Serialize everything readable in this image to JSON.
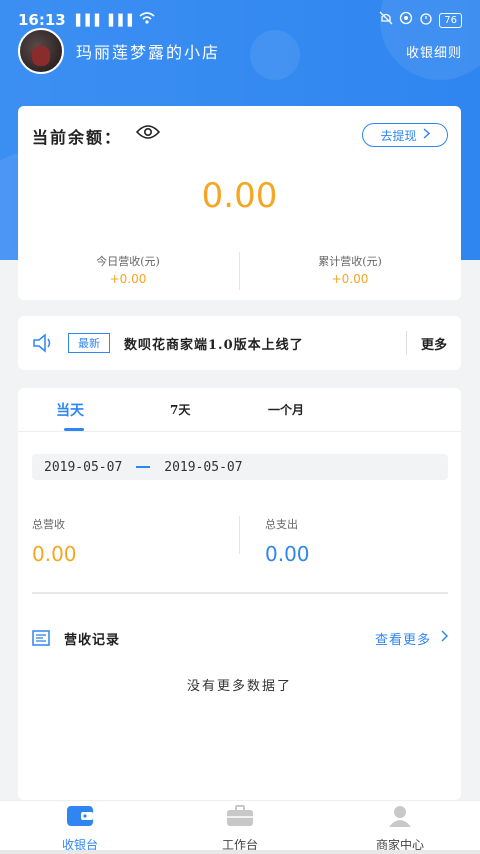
{
  "status_bar": {
    "time": "16:13",
    "signal_text": "▐▐▐ ▐▐▐",
    "battery": "76"
  },
  "header": {
    "shop_name": "玛丽莲梦露的小店",
    "details_link": "收银细则"
  },
  "balance": {
    "title": "当前余额：",
    "withdraw_label": "去提现",
    "amount": "0.00",
    "today_label": "今日营收(元)",
    "today_value": "+0.00",
    "total_label": "累计营收(元)",
    "total_value": "+0.00"
  },
  "notice": {
    "tag": "最新",
    "text": "数呗花商家端1.0版本上线了",
    "more": "更多"
  },
  "tabs": [
    {
      "label": "当天"
    },
    {
      "label": "7天"
    },
    {
      "label": "一个月"
    }
  ],
  "date_range": {
    "start": "2019-05-07",
    "end": "2019-05-07"
  },
  "summary": {
    "income_label": "总营收",
    "income_value": "0.00",
    "expense_label": "总支出",
    "expense_value": "0.00"
  },
  "records": {
    "title": "营收记录",
    "more": "查看更多",
    "empty": "没有更多数据了"
  },
  "tabbar": {
    "items": [
      {
        "label": "收银台",
        "icon": "wallet-icon"
      },
      {
        "label": "工作台",
        "icon": "briefcase-icon"
      },
      {
        "label": "商家中心",
        "icon": "user-icon"
      }
    ]
  },
  "colors": {
    "primary": "#2f86f0",
    "accent": "#f5a623"
  }
}
